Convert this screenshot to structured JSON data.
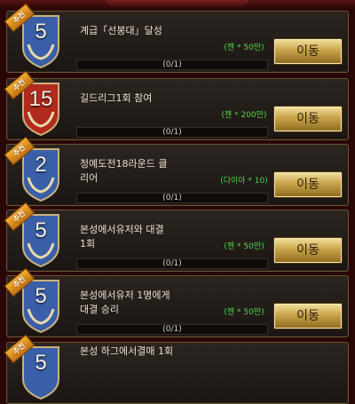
{
  "quests": [
    {
      "level": "5",
      "badge_color": "#3a5fa8",
      "tag": "추천",
      "title_lines": [
        "계급「선봉대」달성",
        ""
      ],
      "reward": "(젠 * 50만)",
      "progress": "(0/1)",
      "button": "이동"
    },
    {
      "level": "15",
      "badge_color": "#b02a1e",
      "tag": "추천",
      "title_lines": [
        "길드리그1회 참여",
        ""
      ],
      "reward": "(젠 * 200만)",
      "progress": "(0/1)",
      "button": "이동"
    },
    {
      "level": "2",
      "badge_color": "#3a5fa8",
      "tag": "추천",
      "title_lines": [
        "정예도전18라운드 클",
        "리어"
      ],
      "reward": "(다이아 * 10)",
      "progress": "(0/1)",
      "button": "이동"
    },
    {
      "level": "5",
      "badge_color": "#3a5fa8",
      "tag": "추천",
      "title_lines": [
        "본성에서유저와 대결",
        "1회"
      ],
      "reward": "(젠 * 50만)",
      "progress": "(0/1)",
      "button": "이동"
    },
    {
      "level": "5",
      "badge_color": "#3a5fa8",
      "tag": "추천",
      "title_lines": [
        "본성에서유저 1명에게",
        "대결 승리"
      ],
      "reward": "(젠 * 50만)",
      "progress": "(0/1)",
      "button": "이동"
    },
    {
      "level": "5",
      "badge_color": "#3a5fa8",
      "tag": "추천",
      "title_lines": [
        "본성 하그에서결매 1회",
        ""
      ],
      "reward": "",
      "progress": "",
      "button": ""
    }
  ]
}
